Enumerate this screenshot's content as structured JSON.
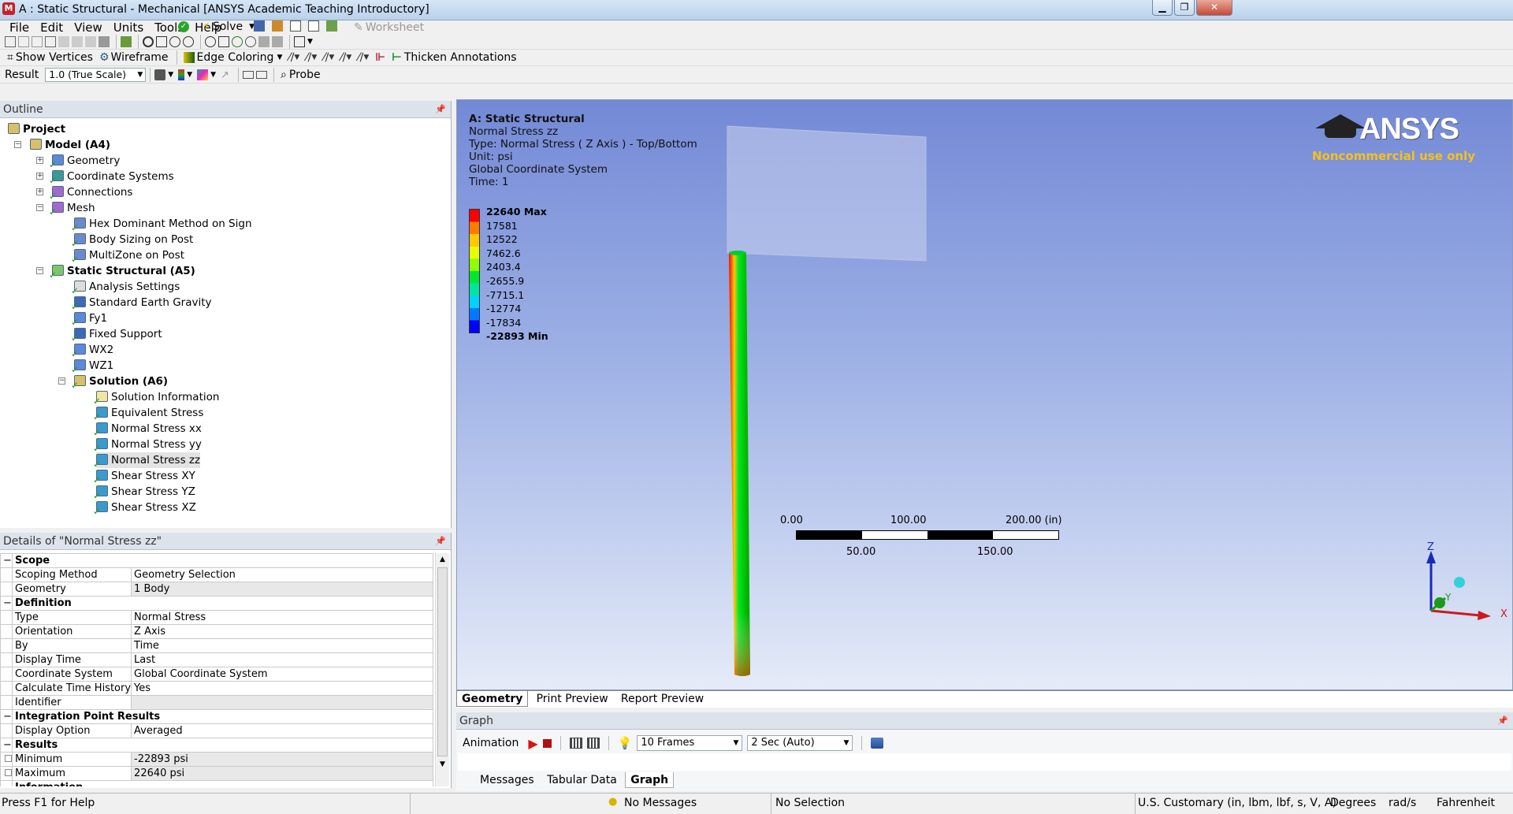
{
  "app": {
    "title": "A : Static Structural - Mechanical [ANSYS Academic Teaching Introductory]"
  },
  "menu": [
    "File",
    "Edit",
    "View",
    "Units",
    "Tools",
    "Help"
  ],
  "toolbar1": {
    "solve_label": "Solve",
    "worksheet_label": "Worksheet"
  },
  "toolbar2": {
    "show_vertices": "Show Vertices",
    "wireframe": "Wireframe",
    "edge_coloring": "Edge Coloring",
    "thicken_annotations": "Thicken Annotations"
  },
  "toolbar3": {
    "result_label": "Result",
    "scale_value": "1.0 (True Scale)",
    "probe_label": "Probe"
  },
  "outline": {
    "header": "Outline",
    "items": [
      {
        "label": "Project",
        "bold": true
      },
      {
        "label": "Model (A4)",
        "bold": true
      },
      {
        "label": "Geometry"
      },
      {
        "label": "Coordinate Systems"
      },
      {
        "label": "Connections"
      },
      {
        "label": "Mesh"
      },
      {
        "label": "Hex Dominant Method on Sign"
      },
      {
        "label": "Body Sizing on Post"
      },
      {
        "label": "MultiZone on Post"
      },
      {
        "label": "Static Structural (A5)",
        "bold": true
      },
      {
        "label": "Analysis Settings"
      },
      {
        "label": "Standard Earth Gravity"
      },
      {
        "label": "Fy1"
      },
      {
        "label": "Fixed Support"
      },
      {
        "label": "WX2"
      },
      {
        "label": "WZ1"
      },
      {
        "label": "Solution (A6)",
        "bold": true
      },
      {
        "label": "Solution Information"
      },
      {
        "label": "Equivalent Stress"
      },
      {
        "label": "Normal Stress xx"
      },
      {
        "label": "Normal Stress yy"
      },
      {
        "label": "Normal Stress zz"
      },
      {
        "label": "Shear Stress XY"
      },
      {
        "label": "Shear Stress YZ"
      },
      {
        "label": "Shear Stress XZ"
      }
    ]
  },
  "details": {
    "header": "Details of \"Normal Stress zz\"",
    "rows": [
      {
        "group": "Scope"
      },
      {
        "k": "Scoping Method",
        "v": "Geometry Selection"
      },
      {
        "k": "Geometry",
        "v": "1 Body"
      },
      {
        "group": "Definition"
      },
      {
        "k": "Type",
        "v": "Normal Stress"
      },
      {
        "k": "Orientation",
        "v": "Z Axis"
      },
      {
        "k": "By",
        "v": "Time"
      },
      {
        "k": "Display Time",
        "v": "Last"
      },
      {
        "k": "Coordinate System",
        "v": "Global Coordinate System"
      },
      {
        "k": "Calculate Time History",
        "v": "Yes"
      },
      {
        "k": "Identifier",
        "v": ""
      },
      {
        "group": "Integration Point Results"
      },
      {
        "k": "Display Option",
        "v": "Averaged"
      },
      {
        "group": "Results"
      },
      {
        "k": "Minimum",
        "v": "-22893 psi"
      },
      {
        "k": "Maximum",
        "v": "22640 psi"
      },
      {
        "group": "Information"
      }
    ]
  },
  "viewport": {
    "info": [
      "A: Static Structural",
      "Normal Stress zz",
      "Type: Normal Stress ( Z Axis ) - Top/Bottom",
      "Unit: psi",
      "Global Coordinate System",
      "Time: 1"
    ],
    "legend": [
      "22640 Max",
      "17581",
      "12522",
      "7462.6",
      "2403.4",
      "-2655.9",
      "-7715.1",
      "-12774",
      "-17834",
      "-22893 Min"
    ],
    "legend_colors": [
      "#ff0000",
      "#ff7a00",
      "#ffc800",
      "#e6ff00",
      "#8cff00",
      "#00e632",
      "#00e6a0",
      "#00d2ff",
      "#0078ff",
      "#0000ff"
    ],
    "logo": "ANSYS",
    "logo_sub": "Noncommercial use only",
    "scale_top": [
      "0.00",
      "100.00",
      "200.00 (in)"
    ],
    "scale_bottom": [
      "50.00",
      "150.00"
    ],
    "axes": {
      "z": "Z",
      "y": "Y",
      "x": "X"
    },
    "tabs": [
      "Geometry",
      "Print Preview",
      "Report Preview"
    ]
  },
  "graph": {
    "header": "Graph",
    "animation_label": "Animation",
    "frames": "10 Frames",
    "duration": "2 Sec (Auto)",
    "tabs": [
      "Messages",
      "Tabular Data",
      "Graph"
    ]
  },
  "status": {
    "help": "Press F1 for Help",
    "messages": "No Messages",
    "selection": "No Selection",
    "units": "U.S. Customary (in, lbm, lbf, s, V, A)",
    "angle": "Degrees",
    "rate": "rad/s",
    "temp": "Fahrenheit"
  }
}
